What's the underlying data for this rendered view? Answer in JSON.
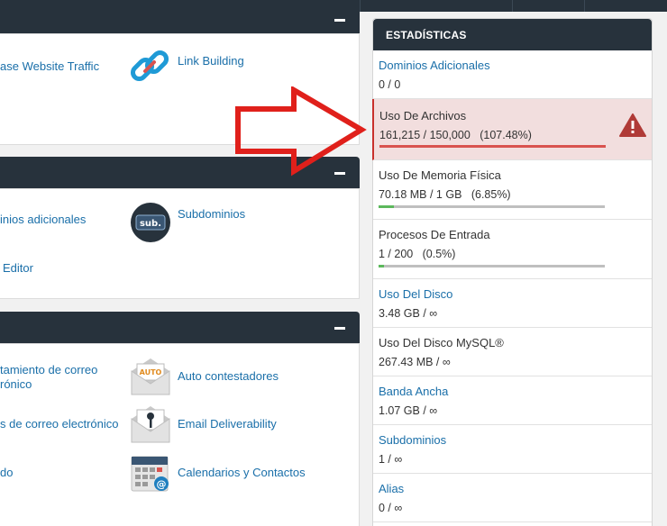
{
  "left": {
    "panel1": {
      "items": [
        {
          "label": "ase Website Traffic"
        },
        {
          "label": "Link Building"
        }
      ]
    },
    "panel2": {
      "items": [
        {
          "label": "inios adicionales"
        },
        {
          "label": "Subdominios",
          "icon_text": "sub."
        },
        {
          "label": "Editor"
        }
      ]
    },
    "panel3": {
      "items": [
        {
          "label": "tamiento de correo\nrónico"
        },
        {
          "label": "Auto contestadores",
          "icon_text": "AUTO"
        },
        {
          "label": "s de correo electrónico"
        },
        {
          "label": "Email Deliverability"
        },
        {
          "label": "do"
        },
        {
          "label": "Calendarios y Contactos"
        }
      ]
    }
  },
  "stats": {
    "title": "ESTADÍSTICAS",
    "rows": [
      {
        "title": "Dominios Adicionales",
        "value": "0 / 0"
      },
      {
        "title": "Uso De Archivos",
        "value": "161,215 / 150,000   (107.48%)",
        "percent": 100,
        "bar_color": "#d9534f"
      },
      {
        "title": "Uso De Memoria Física",
        "value": "70.18 MB / 1 GB   (6.85%)",
        "percent": 6.85,
        "bar_color": "#5cb85c"
      },
      {
        "title": "Procesos De Entrada",
        "value": "1 / 200   (0.5%)",
        "percent": 0.5,
        "bar_color": "#5cb85c"
      },
      {
        "title": "Uso Del Disco",
        "value": "3.48 GB / ∞"
      },
      {
        "title": "Uso Del Disco MySQL®",
        "value": "267.43 MB / ∞"
      },
      {
        "title": "Banda Ancha",
        "value": "1.07 GB / ∞"
      },
      {
        "title": "Subdominios",
        "value": "1 / ∞"
      },
      {
        "title": "Alias",
        "value": "0 / ∞"
      }
    ]
  }
}
